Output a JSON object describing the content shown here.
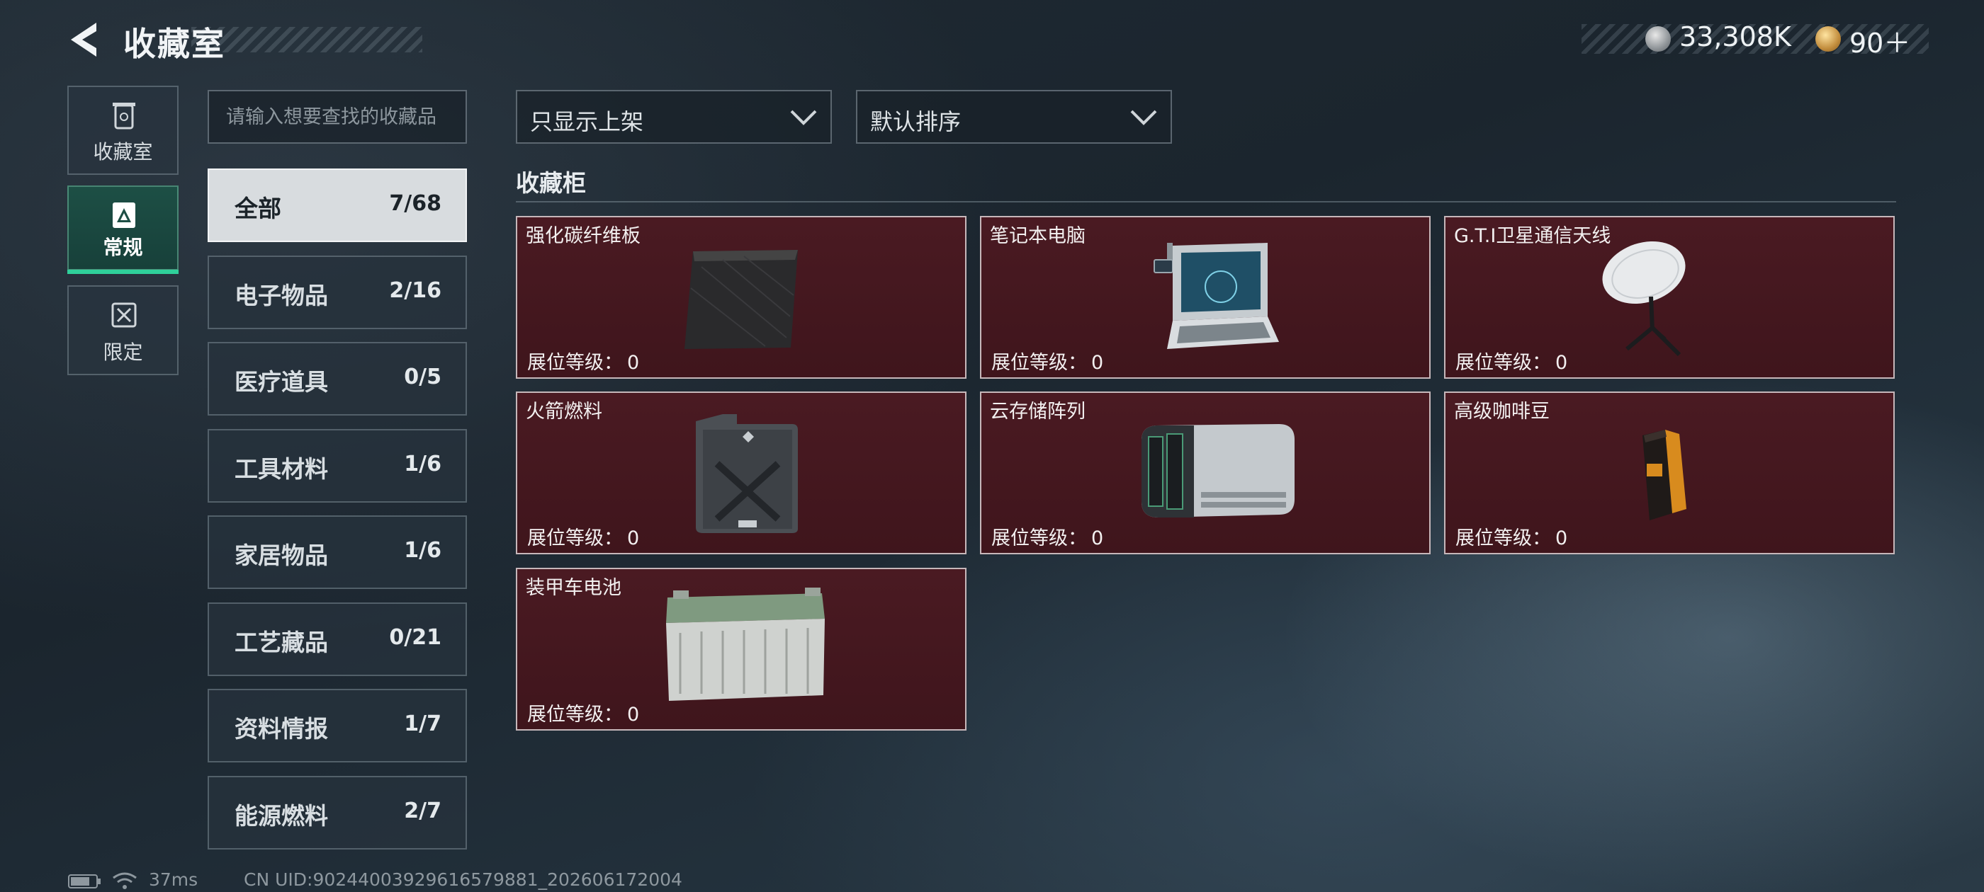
{
  "header": {
    "title": "收藏室",
    "back_icon": "back-arrow-icon"
  },
  "currency": {
    "silver": "33,308K",
    "gold": "90＋"
  },
  "rail": [
    {
      "label": "收藏室",
      "icon": "trash-bin-icon",
      "active": false
    },
    {
      "label": "常规",
      "icon": "shield-triangle-icon",
      "active": true
    },
    {
      "label": "限定",
      "icon": "cross-mark-icon",
      "active": false
    }
  ],
  "search": {
    "placeholder": "请输入想要查找的收藏品",
    "value": ""
  },
  "categories": [
    {
      "name": "全部",
      "count": "7/68",
      "active": true
    },
    {
      "name": "电子物品",
      "count": "2/16"
    },
    {
      "name": "医疗道具",
      "count": "0/5"
    },
    {
      "name": "工具材料",
      "count": "1/6"
    },
    {
      "name": "家居物品",
      "count": "1/6"
    },
    {
      "name": "工艺藏品",
      "count": "0/21"
    },
    {
      "name": "资料情报",
      "count": "1/7"
    },
    {
      "name": "能源燃料",
      "count": "2/7"
    }
  ],
  "filters": {
    "show_only": "只显示上架",
    "sort": "默认排序"
  },
  "section_title": "收藏柜",
  "level_label": "展位等级：",
  "items": [
    {
      "name": "强化碳纤维板",
      "level": "0"
    },
    {
      "name": "笔记本电脑",
      "level": "0"
    },
    {
      "name": "G.T.I卫星通信天线",
      "level": "0"
    },
    {
      "name": "火箭燃料",
      "level": "0"
    },
    {
      "name": "云存储阵列",
      "level": "0"
    },
    {
      "name": "高级咖啡豆",
      "level": "0"
    },
    {
      "name": "装甲车电池",
      "level": "0"
    }
  ],
  "footer": {
    "ping": "37ms",
    "uid": "CN UID:902440039296165798​81_202606172004"
  },
  "colors": {
    "accent": "#2fd09a",
    "card_bg": "#4a1a22",
    "card_border": "#c6b7ba"
  }
}
